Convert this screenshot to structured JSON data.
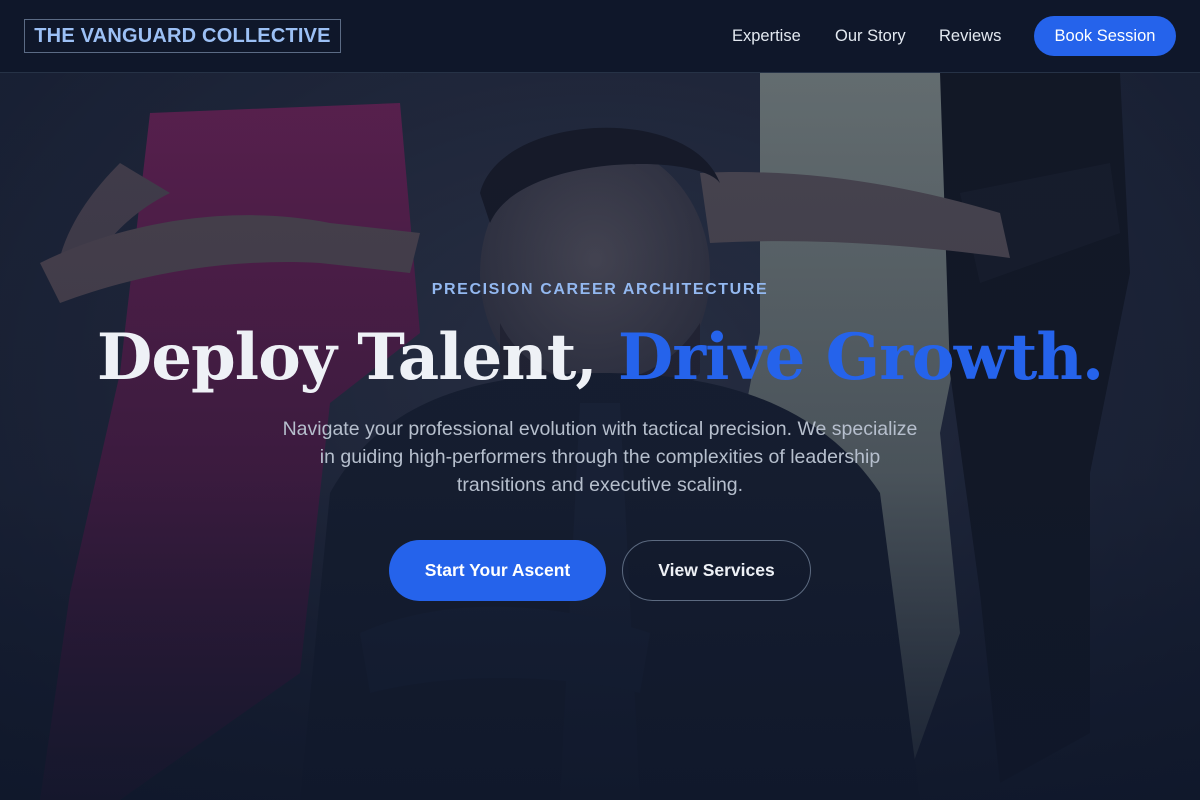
{
  "header": {
    "brand": "THE VANGUARD COLLECTIVE",
    "nav": [
      {
        "label": "Expertise"
      },
      {
        "label": "Our Story"
      },
      {
        "label": "Reviews"
      }
    ],
    "cta_label": "Book Session"
  },
  "hero": {
    "eyebrow": "PRECISION CAREER ARCHITECTURE",
    "headline_part1": "Deploy Talent,",
    "headline_part2": "Drive Growth.",
    "subtitle": "Navigate your professional evolution with tactical precision. We specialize in guiding high-performers through the complexities of leadership transitions and executive scaling.",
    "primary_button": "Start Your Ascent",
    "secondary_button": "View Services",
    "background_image": "team-photo-watermarked"
  },
  "colors": {
    "accent": "#2563eb",
    "background": "#0f172a",
    "brand_text": "#9cc0f5",
    "eyebrow_text": "#93b8f0"
  }
}
